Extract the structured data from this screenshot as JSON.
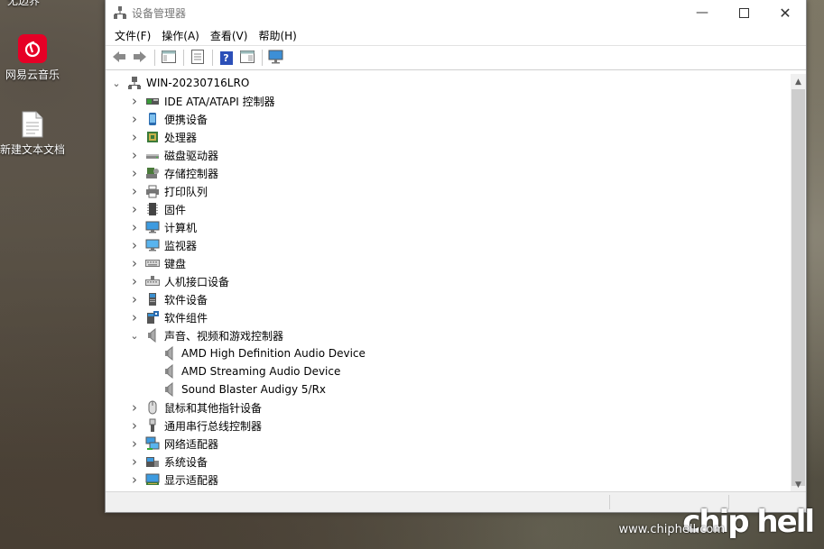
{
  "desktop": {
    "top_text": "无边界",
    "icons": [
      {
        "label": "网易云音乐",
        "icon": "netease-music-icon",
        "color": "#e60026"
      },
      {
        "label": "新建文本文档",
        "icon": "text-file-icon"
      }
    ]
  },
  "window": {
    "title": "设备管理器",
    "menu": [
      "文件(F)",
      "操作(A)",
      "查看(V)",
      "帮助(H)"
    ],
    "root": "WIN-20230716LRO",
    "tree": [
      {
        "label": "IDE ATA/ATAPI 控制器",
        "icon": "ide-controller-icon",
        "expanded": false
      },
      {
        "label": "便携设备",
        "icon": "portable-device-icon",
        "expanded": false
      },
      {
        "label": "处理器",
        "icon": "processor-icon",
        "expanded": false
      },
      {
        "label": "磁盘驱动器",
        "icon": "disk-drive-icon",
        "expanded": false
      },
      {
        "label": "存储控制器",
        "icon": "storage-controller-icon",
        "expanded": false
      },
      {
        "label": "打印队列",
        "icon": "printer-icon",
        "expanded": false
      },
      {
        "label": "固件",
        "icon": "firmware-icon",
        "expanded": false
      },
      {
        "label": "计算机",
        "icon": "computer-icon",
        "expanded": false
      },
      {
        "label": "监视器",
        "icon": "monitor-icon",
        "expanded": false
      },
      {
        "label": "键盘",
        "icon": "keyboard-icon",
        "expanded": false
      },
      {
        "label": "人机接口设备",
        "icon": "hid-icon",
        "expanded": false
      },
      {
        "label": "软件设备",
        "icon": "software-device-icon",
        "expanded": false
      },
      {
        "label": "软件组件",
        "icon": "software-component-icon",
        "expanded": false
      },
      {
        "label": "声音、视频和游戏控制器",
        "icon": "speaker-icon",
        "expanded": true,
        "children": [
          "AMD High Definition Audio Device",
          "AMD Streaming Audio Device",
          "Sound Blaster Audigy 5/Rx"
        ]
      },
      {
        "label": "鼠标和其他指针设备",
        "icon": "mouse-icon",
        "expanded": false
      },
      {
        "label": "通用串行总线控制器",
        "icon": "usb-icon",
        "expanded": false
      },
      {
        "label": "网络适配器",
        "icon": "network-adapter-icon",
        "expanded": false
      },
      {
        "label": "系统设备",
        "icon": "system-device-icon",
        "expanded": false
      },
      {
        "label": "显示适配器",
        "icon": "display-adapter-icon",
        "expanded": false
      }
    ]
  },
  "watermark": {
    "site": "www.chiphell.com",
    "logo": "chip hell"
  }
}
